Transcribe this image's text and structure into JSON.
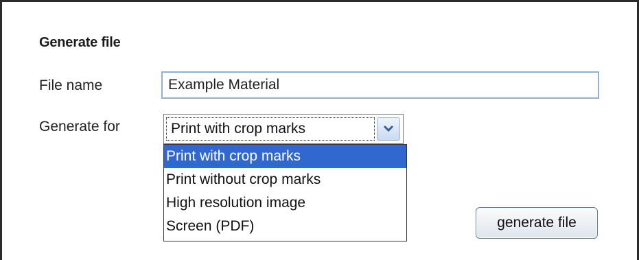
{
  "form": {
    "title": "Generate file",
    "file_name_label": "File name",
    "file_name_value": "Example Material",
    "generate_for_label": "Generate for",
    "generate_for_selected": "Print with crop marks",
    "generate_for_options": [
      "Print with crop marks",
      "Print without crop marks",
      "High resolution image",
      "Screen (PDF)"
    ],
    "generate_button_label": "generate file"
  },
  "icons": {
    "dropdown_arrow": "chevron-down-icon"
  },
  "colors": {
    "selected_option_bg": "#3168d0",
    "input_border": "#8fb2d6"
  }
}
